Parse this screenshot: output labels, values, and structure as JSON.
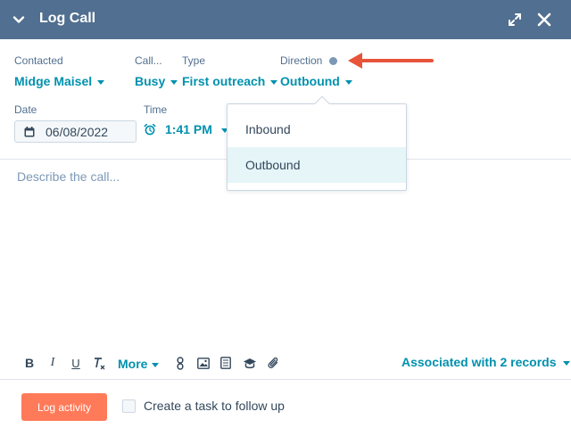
{
  "header": {
    "title": "Log Call",
    "bg_color": "#516f90"
  },
  "fields": {
    "contacted": {
      "label": "Contacted",
      "value": "Midge Maisel"
    },
    "outcome": {
      "label": "Call...",
      "value": "Busy"
    },
    "type": {
      "label": "Type",
      "value": "First outreach"
    },
    "direction": {
      "label": "Direction",
      "value": "Outbound"
    },
    "date": {
      "label": "Date",
      "value": "06/08/2022"
    },
    "time": {
      "label": "Time",
      "value": "1:41 PM"
    }
  },
  "editor": {
    "placeholder": "Describe the call..."
  },
  "direction_dropdown": {
    "options": [
      {
        "label": "Inbound",
        "selected": false
      },
      {
        "label": "Outbound",
        "selected": true
      }
    ]
  },
  "toolbar": {
    "more_label": "More",
    "associated_label": "Associated with 2 records",
    "icons": [
      "bold-icon",
      "italic-icon",
      "underline-icon",
      "clear-format-icon",
      "link-icon",
      "image-icon",
      "document-icon",
      "template-icon",
      "attachment-icon"
    ]
  },
  "footer": {
    "log_button": "Log activity",
    "followup_label": "Create a task to follow up",
    "followup_checked": false
  },
  "colors": {
    "accent": "#0091ae",
    "primary_button": "#ff7a59",
    "annotation_arrow": "#e8543a",
    "selected_option_bg": "#e5f5f8"
  }
}
